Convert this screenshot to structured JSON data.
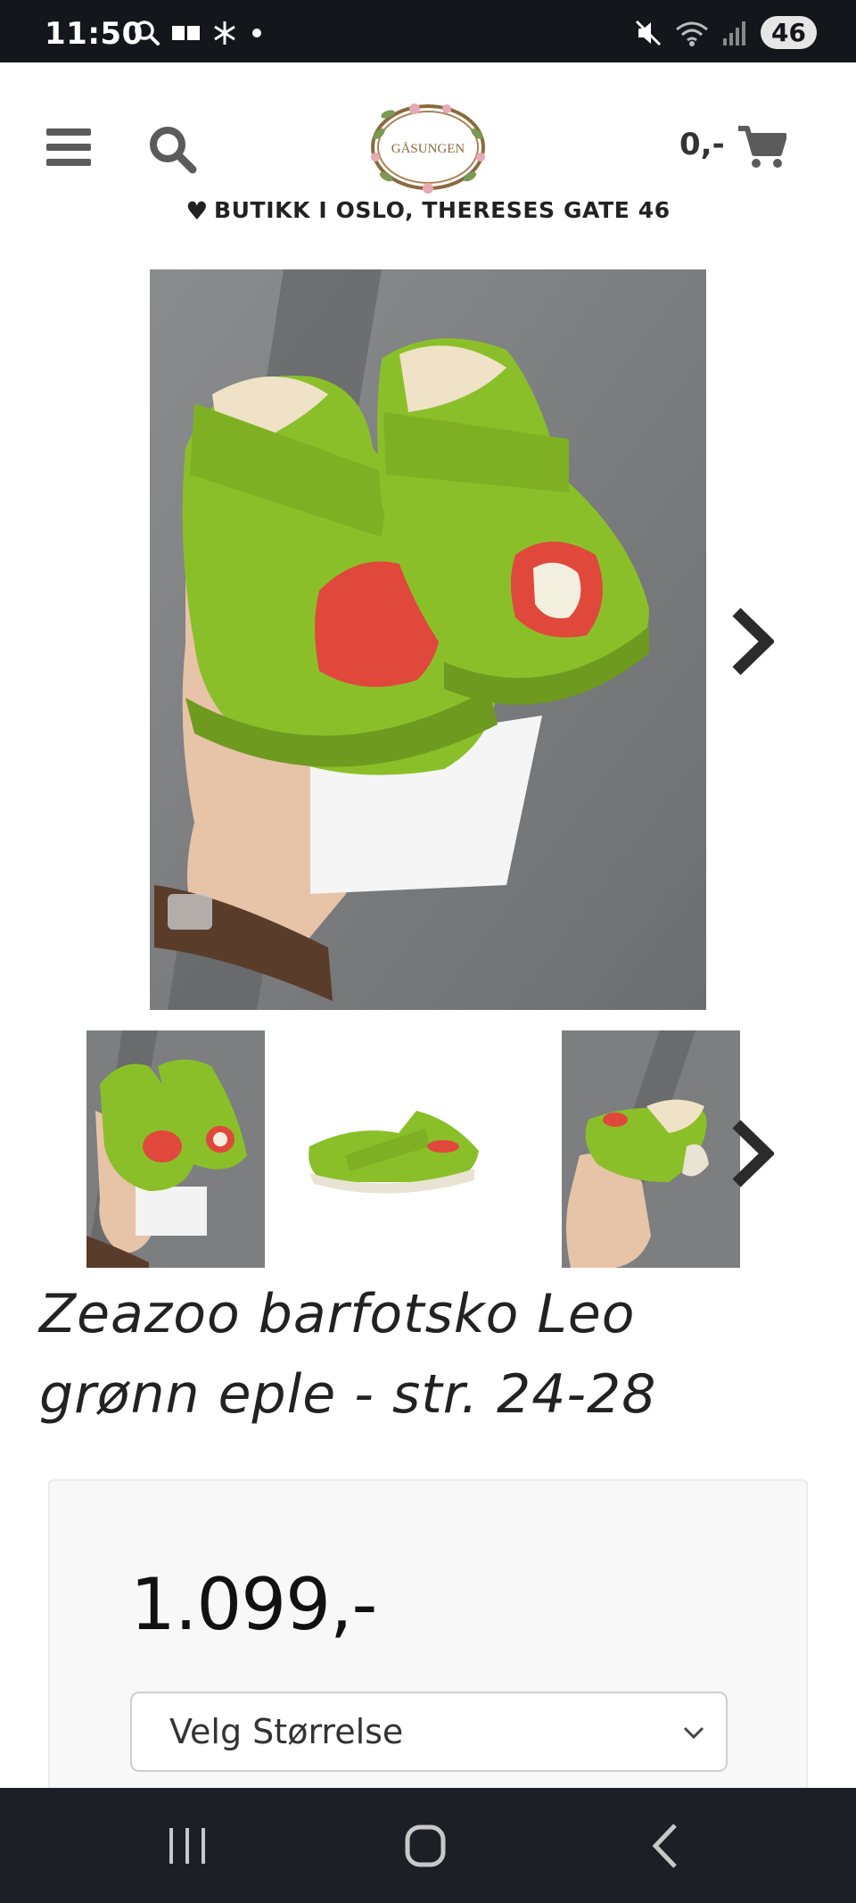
{
  "status_bar": {
    "time": "11:50",
    "battery": "46",
    "icons": [
      "search-icon",
      "message-icon",
      "snowflake-icon",
      "dot-icon",
      "mute-icon",
      "wifi-icon",
      "signal-icon"
    ]
  },
  "header": {
    "logo_text": "GÅSUNGEN",
    "cart_amount": "0,-",
    "store_banner": "BUTIKK I OSLO, THERESES GATE 46"
  },
  "product": {
    "title": "Zeazoo barfotsko Leo grønn eple - str. 24-28",
    "price": "1.099,-",
    "size_select": {
      "selected": "Velg Størrelse"
    }
  },
  "colors": {
    "status_bar_bg": "#15151c",
    "nav_bar_bg": "#1d1f26",
    "shoe_green": "#8bbf2a",
    "apple_red": "#e0483c"
  }
}
